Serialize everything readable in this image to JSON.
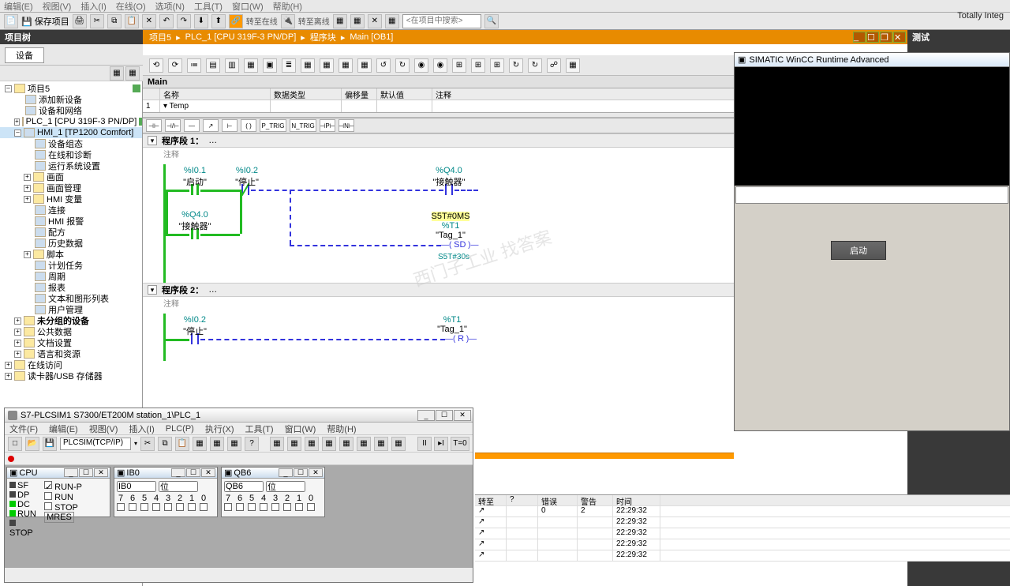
{
  "brand": "Totally Integ",
  "menubar": [
    "编辑(E)",
    "视图(V)",
    "插入(I)",
    "在线(O)",
    "选项(N)",
    "工具(T)",
    "窗口(W)",
    "帮助(H)"
  ],
  "saveLabel": "保存项目",
  "searchPlaceholder": "<在项目中搜索>",
  "projectTree": {
    "title": "项目树",
    "deviceTab": "设备"
  },
  "tree": [
    {
      "t": "项目5",
      "lvl": 0,
      "exp": "▾",
      "ic": "folder",
      "tick": true
    },
    {
      "t": "添加新设备",
      "lvl": 1,
      "ic": "dev"
    },
    {
      "t": "设备和网络",
      "lvl": 1,
      "ic": "dev"
    },
    {
      "t": "PLC_1 [CPU 319F-3 PN/DP]",
      "lvl": 1,
      "exp": "▸",
      "ic": "dev",
      "sel": false,
      "tick": true,
      "dot": true
    },
    {
      "t": "HMI_1 [TP1200 Comfort]",
      "lvl": 1,
      "exp": "▾",
      "ic": "dev",
      "sel": true
    },
    {
      "t": "设备组态",
      "lvl": 2,
      "ic": "dev"
    },
    {
      "t": "在线和诊断",
      "lvl": 2,
      "ic": "dev"
    },
    {
      "t": "运行系统设置",
      "lvl": 2,
      "ic": "dev"
    },
    {
      "t": "画面",
      "lvl": 2,
      "exp": "▸",
      "ic": "folder"
    },
    {
      "t": "画面管理",
      "lvl": 2,
      "exp": "▸",
      "ic": "folder"
    },
    {
      "t": "HMI 变量",
      "lvl": 2,
      "exp": "▸",
      "ic": "folder"
    },
    {
      "t": "连接",
      "lvl": 2,
      "ic": "dev"
    },
    {
      "t": "HMI 报警",
      "lvl": 2,
      "ic": "dev"
    },
    {
      "t": "配方",
      "lvl": 2,
      "ic": "dev"
    },
    {
      "t": "历史数据",
      "lvl": 2,
      "ic": "dev"
    },
    {
      "t": "脚本",
      "lvl": 2,
      "exp": "▸",
      "ic": "folder"
    },
    {
      "t": "计划任务",
      "lvl": 2,
      "ic": "dev"
    },
    {
      "t": "周期",
      "lvl": 2,
      "ic": "dev"
    },
    {
      "t": "报表",
      "lvl": 2,
      "ic": "dev"
    },
    {
      "t": "文本和图形列表",
      "lvl": 2,
      "ic": "dev"
    },
    {
      "t": "用户管理",
      "lvl": 2,
      "ic": "dev"
    },
    {
      "t": "未分组的设备",
      "lvl": 1,
      "exp": "▸",
      "ic": "folder",
      "bold": true
    },
    {
      "t": "公共数据",
      "lvl": 1,
      "exp": "▸",
      "ic": "folder"
    },
    {
      "t": "文档设置",
      "lvl": 1,
      "exp": "▸",
      "ic": "folder"
    },
    {
      "t": "语言和资源",
      "lvl": 1,
      "exp": "▸",
      "ic": "folder"
    },
    {
      "t": "在线访问",
      "lvl": 0,
      "exp": "▸",
      "ic": "folder"
    },
    {
      "t": "读卡器/USB 存储器",
      "lvl": 0,
      "exp": "▸",
      "ic": "folder"
    }
  ],
  "breadcrumb": [
    "项目5",
    "PLC_1 [CPU 319F-3 PN/DP]",
    "程序块",
    "Main [OB1]"
  ],
  "rightTitle": "测试",
  "block": {
    "title": "Main",
    "varHdr": [
      "",
      "名称",
      "数据类型",
      "偏移量",
      "默认值",
      "注释"
    ],
    "varRow": [
      "1",
      "▾ Temp",
      "",
      "",
      "",
      ""
    ],
    "ladBtns": [
      "⊣⊢",
      "⊣/⊢",
      "—",
      "↗",
      "⊢",
      "( )",
      "P_TRIG",
      "N_TRIG",
      "⊣P⊢",
      "⊣N⊢"
    ]
  },
  "networks": [
    {
      "title": "程序段 1：",
      "comment": "注释"
    },
    {
      "title": "程序段 2：",
      "comment": "注释"
    }
  ],
  "tags": {
    "i01": {
      "addr": "%I0.1",
      "name": "\"启动\""
    },
    "i02": {
      "addr": "%I0.2",
      "name": "\"停止\""
    },
    "q40a": {
      "addr": "%Q4.0",
      "name": "\"接触器\""
    },
    "q40b": {
      "addr": "%Q4.0",
      "name": "\"接触器\""
    },
    "t1": {
      "addr": "%T1",
      "name": "\"Tag_1\""
    },
    "pt": "S5T#0MS",
    "tv": "S5T#30s",
    "sd": "SD",
    "r": "R"
  },
  "wincc": {
    "title": "SIMATIC WinCC Runtime Advanced",
    "hmiBtn": "启动"
  },
  "plcsim": {
    "title": "S7-PLCSIM1    S7300/ET200M station_1\\PLC_1",
    "menu": [
      "文件(F)",
      "编辑(E)",
      "视图(V)",
      "插入(I)",
      "PLC(P)",
      "执行(X)",
      "工具(T)",
      "窗口(W)",
      "帮助(H)"
    ],
    "iface": "PLCSIM(TCP/IP)",
    "cpu": {
      "title": "CPU",
      "states": [
        "SF",
        "DP",
        "DC",
        "RUN",
        "STOP"
      ],
      "runp": "RUN-P",
      "run": "RUN",
      "stop": "STOP",
      "mres": "MRES"
    },
    "ib0": {
      "title": "IB0",
      "sel": "IB0",
      "fmt": "位",
      "bits": [
        "7",
        "6",
        "5",
        "4",
        "3",
        "2",
        "1",
        "0"
      ]
    },
    "qb6": {
      "title": "QB6",
      "sel": "QB6",
      "fmt": "位",
      "bits": [
        "7",
        "6",
        "5",
        "4",
        "3",
        "2",
        "1",
        "0"
      ]
    },
    "tbR": [
      "II",
      "▸I",
      "T=0"
    ]
  },
  "msgs": {
    "hdr": [
      "转至",
      "?",
      "错误",
      "警告",
      "时间"
    ],
    "rows": [
      [
        "↗",
        "",
        "0",
        "2",
        "22:29:32"
      ],
      [
        "↗",
        "",
        "",
        "",
        "22:29:32"
      ],
      [
        "↗",
        "",
        "",
        "",
        "22:29:32"
      ],
      [
        "↗",
        "",
        "",
        "",
        "22:29:32"
      ],
      [
        "↗",
        "",
        "",
        "",
        "22:29:32"
      ]
    ]
  },
  "watermark": "西门子工业  找答案"
}
